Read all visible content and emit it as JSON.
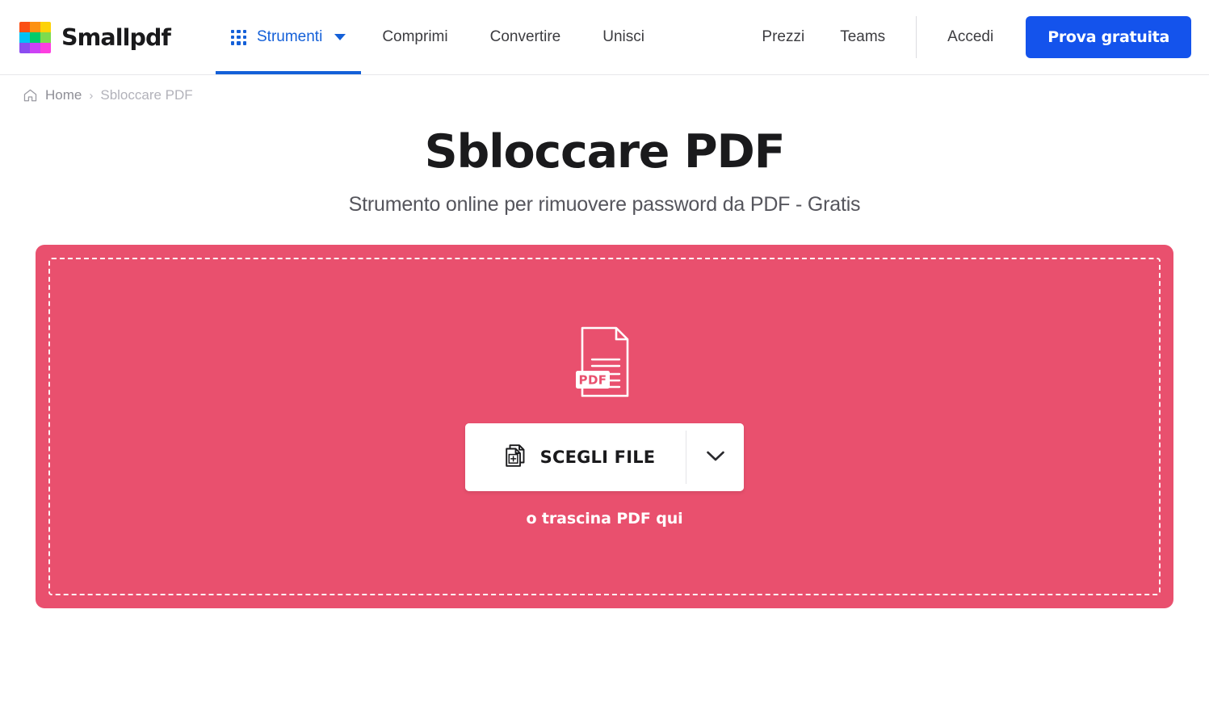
{
  "header": {
    "brand": {
      "name": "Smallpdf",
      "logo_icon": "smallpdf-grid-logo",
      "logo_colors": [
        "#fb4f14",
        "#fd9111",
        "#fdd207",
        "#00c2f5",
        "#00cc6a",
        "#7ddc4e",
        "#8b4cf0",
        "#cc42f5",
        "#fd3fe0"
      ]
    },
    "nav": {
      "tools": {
        "label": "Strumenti",
        "grid_icon": "apps-grid-icon",
        "caret_icon": "caret-down-icon",
        "active": true
      },
      "items": [
        {
          "label": "Comprimi"
        },
        {
          "label": "Convertire"
        },
        {
          "label": "Unisci"
        }
      ]
    },
    "right": {
      "links": [
        {
          "label": "Prezzi"
        },
        {
          "label": "Teams"
        }
      ],
      "signin_label": "Accedi",
      "cta_label": "Prova gratuita",
      "cta_color": "#1453ec",
      "accent_color": "#1460d8"
    }
  },
  "breadcrumb": {
    "home_icon": "home-icon",
    "home_label": "Home",
    "separator": "›",
    "current_label": "Sbloccare PDF"
  },
  "hero": {
    "title": "Sbloccare PDF",
    "subtitle": "Strumento online per rimuovere password da PDF - Gratis"
  },
  "dropzone": {
    "background_color": "#e9506e",
    "file_icon": "pdf-document-icon",
    "file_icon_badge": "PDF",
    "choose_file_icon": "add-file-icon",
    "choose_file_label": "SCEGLI FILE",
    "dropdown_icon": "chevron-down-icon",
    "drag_hint": "o trascina PDF qui"
  }
}
